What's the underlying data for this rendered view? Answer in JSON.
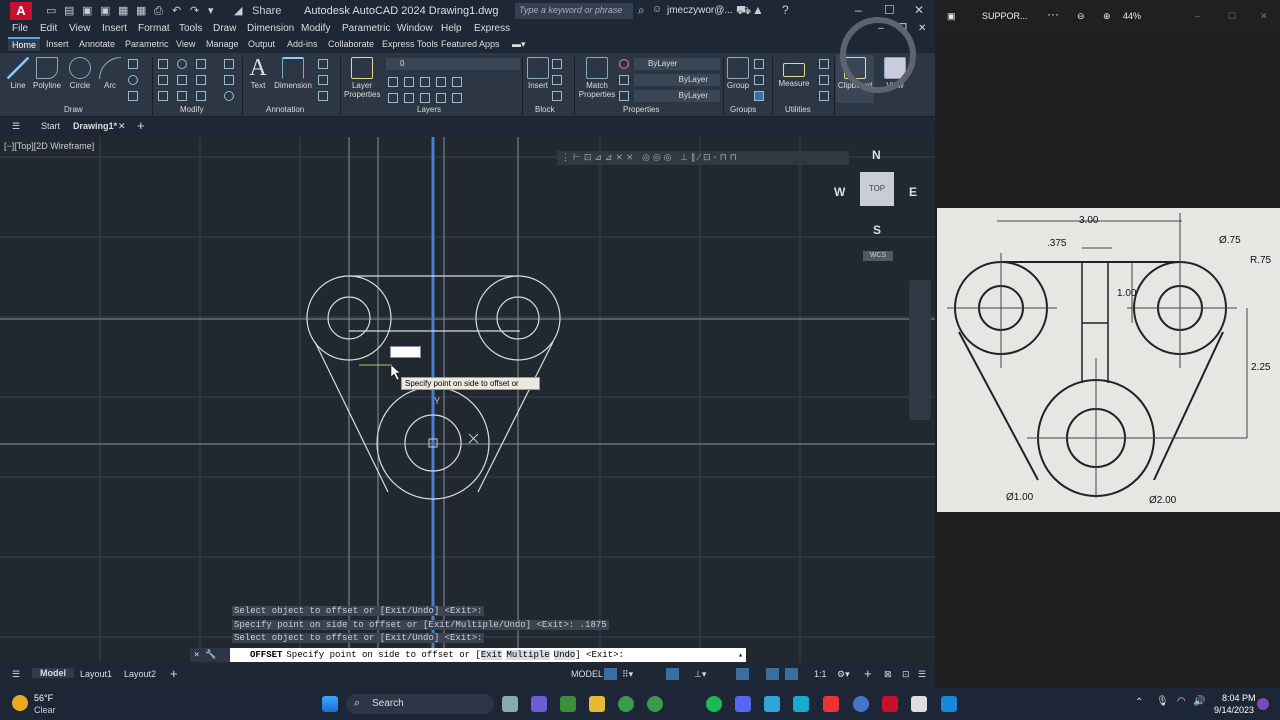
{
  "app": {
    "logo_letter": "A",
    "window_title": "Autodesk AutoCAD 2024   Drawing1.dwg",
    "share_label": "Share",
    "search_placeholder": "Type a keyword or phrase",
    "user_name": "jmeczywor@..."
  },
  "menu": [
    "File",
    "Edit",
    "View",
    "Insert",
    "Format",
    "Tools",
    "Draw",
    "Dimension",
    "Modify",
    "Parametric",
    "Window",
    "Help",
    "Express"
  ],
  "ribbon_tabs": [
    "Home",
    "Insert",
    "Annotate",
    "Parametric",
    "View",
    "Manage",
    "Output",
    "Add-ins",
    "Collaborate",
    "Express Tools",
    "Featured Apps"
  ],
  "ribbon": {
    "draw_tools": [
      "Line",
      "Polyline",
      "Circle",
      "Arc"
    ],
    "annotation_tools": [
      "Text",
      "Dimension"
    ],
    "layer_properties": "Layer Properties",
    "layer_value": "0",
    "insert": "Insert",
    "match_properties": "Match Properties",
    "bylayer_color": "ByLayer",
    "bylayer_line": "ByLayer",
    "bylayer_weight": "ByLayer",
    "group": "Group",
    "measure": "Measure",
    "clipboard": "Clipboard",
    "view": "View",
    "sections": [
      "Draw",
      "Modify",
      "Annotation",
      "Layers",
      "Block",
      "Properties",
      "Groups",
      "Utilities"
    ]
  },
  "file_tabs": {
    "start": "Start",
    "drawing": "Drawing1*"
  },
  "viewport": {
    "label": "[−][Top][2D Wireframe]",
    "compass": {
      "n": "N",
      "s": "S",
      "e": "E",
      "w": "W",
      "face": "TOP",
      "wcs": "WCS"
    },
    "tooltip": "Specify point on side to offset or",
    "ucs_y": "Y"
  },
  "command_history": [
    "Select object to offset or [Exit/Undo] <Exit>:",
    "Specify point on side to offset or [Exit/Multiple/Undo] <Exit>: .1875",
    "Select object to offset or [Exit/Undo] <Exit>:"
  ],
  "command_line": {
    "command": "OFFSET",
    "prompt": "Specify point on side to offset or [",
    "opt1": "Exit",
    "opt2": "Multiple",
    "opt3": "Undo",
    "tail": "] <Exit>:"
  },
  "statusbar": {
    "model_tab": "Model",
    "layout1": "Layout1",
    "layout2": "Layout2",
    "model_label": "MODEL",
    "scale": "1:1"
  },
  "right_panel": {
    "title": "SUPPOR...",
    "zoom": "44%",
    "sketch_labels": {
      "width": "3.00",
      "slot_width": ".375",
      "hole_small": "Ø.75",
      "radius": "R.75",
      "slot_height": "1.00",
      "vertical": "2.25",
      "hole_center": "Ø1.00",
      "circle_big": "Ø2.00"
    }
  },
  "taskbar": {
    "weather_temp": "56°F",
    "weather_cond": "Clear",
    "search": "Search",
    "time": "8:04 PM",
    "date": "9/14/2023"
  }
}
